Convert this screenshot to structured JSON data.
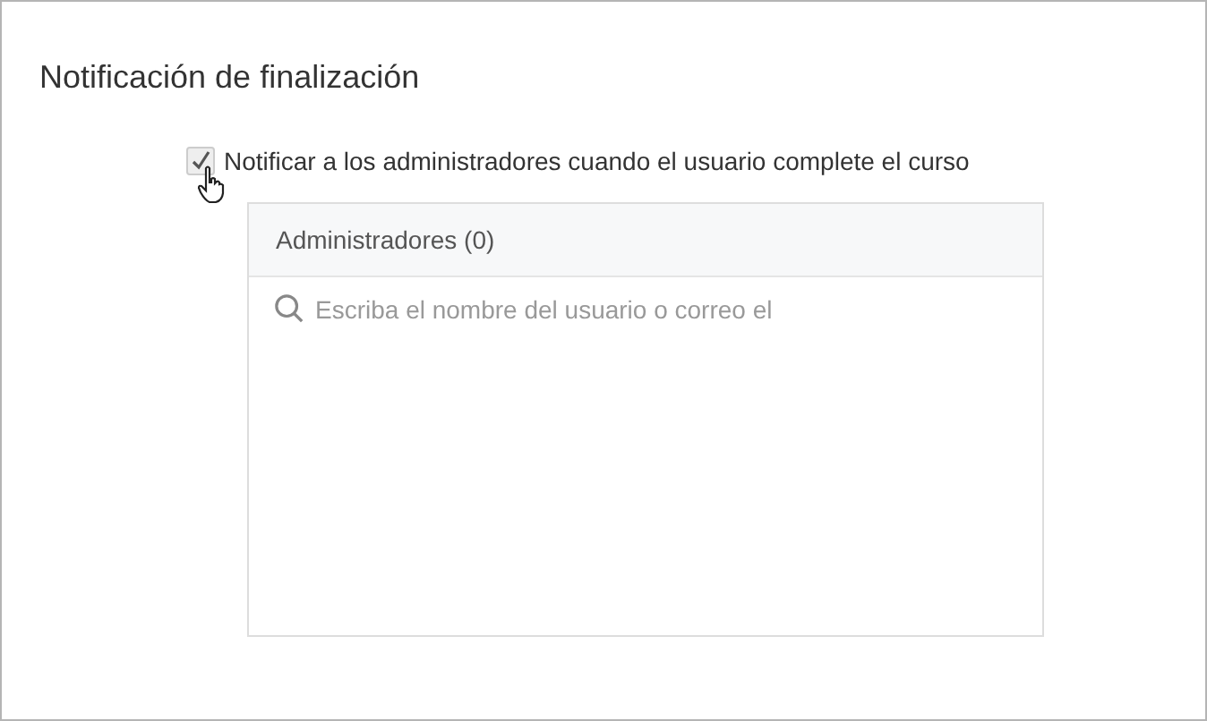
{
  "section": {
    "title": "Notificación de finalización"
  },
  "notify_checkbox": {
    "label": "Notificar a los administradores cuando el usuario complete el curso",
    "checked": true
  },
  "admins_panel": {
    "header": "Administradores (0)",
    "search": {
      "placeholder": "Escriba el nombre del usuario o correo el"
    }
  }
}
